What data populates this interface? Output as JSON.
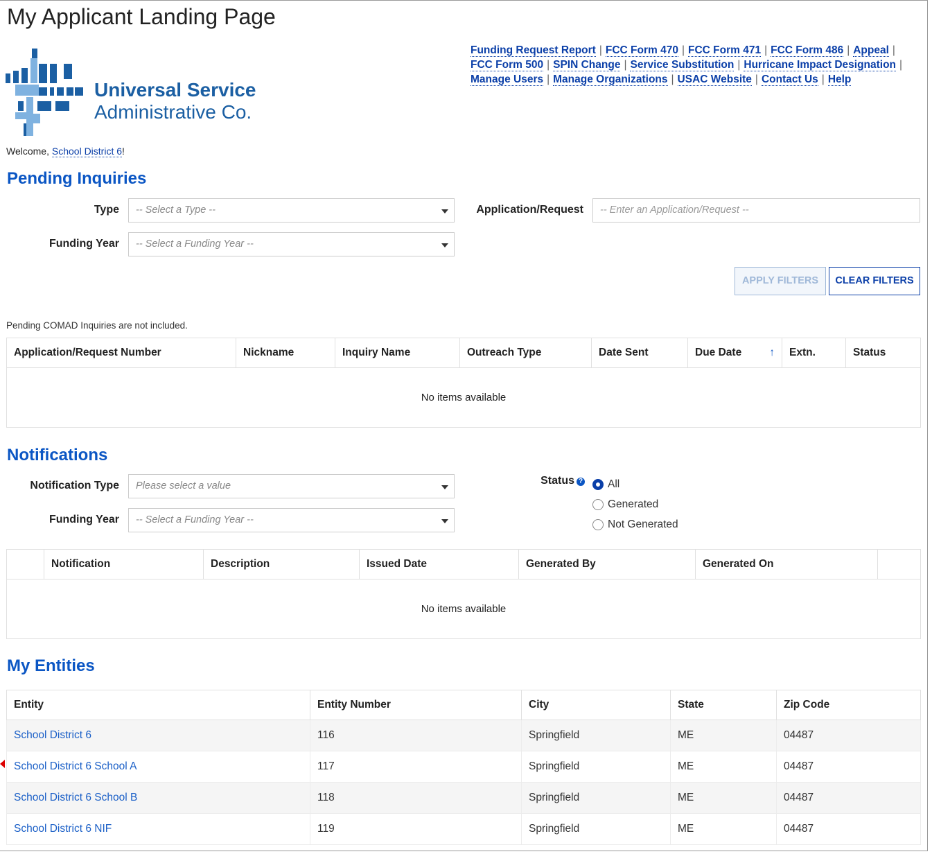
{
  "page": {
    "title": "My Applicant Landing Page"
  },
  "logo": {
    "line1": "Universal Service",
    "line2": "Administrative Co."
  },
  "top_links": [
    "Funding Request Report",
    "FCC Form 470",
    "FCC Form 471",
    "FCC Form 486",
    "Appeal",
    "FCC Form 500",
    "SPIN Change",
    "Service Substitution",
    "Hurricane Impact Designation",
    "Manage Users",
    "Manage Organizations",
    "USAC Website",
    "Contact Us",
    "Help"
  ],
  "welcome": {
    "prefix": "Welcome, ",
    "user": "School District 6",
    "suffix": "!"
  },
  "pending": {
    "title": "Pending Inquiries",
    "type_label": "Type",
    "type_placeholder": "-- Select a Type --",
    "app_label": "Application/Request",
    "app_placeholder": "-- Enter an Application/Request --",
    "fy_label": "Funding Year",
    "fy_placeholder": "-- Select a Funding Year --",
    "apply_label": "APPLY FILTERS",
    "clear_label": "CLEAR FILTERS",
    "note": "Pending COMAD Inquiries are not included.",
    "columns": [
      "Application/Request Number",
      "Nickname",
      "Inquiry Name",
      "Outreach Type",
      "Date Sent",
      "Due Date",
      "Extn.",
      "Status"
    ],
    "sort_indicator": "↑",
    "empty": "No items available"
  },
  "notifications": {
    "title": "Notifications",
    "type_label": "Notification Type",
    "type_placeholder": "Please select a value",
    "fy_label": "Funding Year",
    "fy_placeholder": "-- Select a Funding Year --",
    "status_label": "Status",
    "status_options": [
      "All",
      "Generated",
      "Not Generated"
    ],
    "status_selected": "All",
    "columns": [
      "",
      "Notification",
      "Description",
      "Issued Date",
      "Generated By",
      "Generated On",
      ""
    ],
    "empty": "No items available"
  },
  "entities": {
    "title": "My Entities",
    "columns": [
      "Entity",
      "Entity Number",
      "City",
      "State",
      "Zip Code"
    ],
    "rows": [
      [
        "School District 6",
        "116",
        "Springfield",
        "ME",
        "04487"
      ],
      [
        "School District 6 School A",
        "117",
        "Springfield",
        "ME",
        "04487"
      ],
      [
        "School District 6 School B",
        "118",
        "Springfield",
        "ME",
        "04487"
      ],
      [
        "School District 6 NIF",
        "119",
        "Springfield",
        "ME",
        "04487"
      ]
    ]
  },
  "colors": {
    "link": "#0b3fa8",
    "heading": "#0b56c4",
    "logo": "#1b5fa3",
    "annotation": "#dd0000"
  }
}
